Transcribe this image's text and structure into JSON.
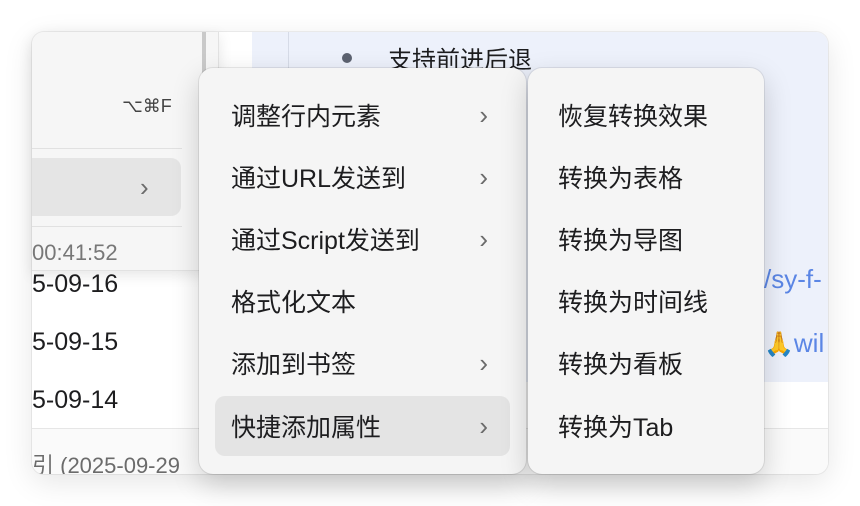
{
  "background": {
    "bullet_text": "支持前进后退",
    "link_a": "/sy-f-",
    "link_b_emoji": "🙏",
    "link_b_text": "wil",
    "dates": [
      "5-09-16",
      "5-09-15",
      "5-09-14"
    ],
    "footer_text": "引 (2025-09-29"
  },
  "left_popover": {
    "shortcut": "⌥⌘F",
    "chevron": "›",
    "time_text": "00:41:52"
  },
  "primary_menu": {
    "items": [
      {
        "label": "调整行内元素",
        "has_submenu": true
      },
      {
        "label": "通过URL发送到",
        "has_submenu": true
      },
      {
        "label": "通过Script发送到",
        "has_submenu": true
      },
      {
        "label": "格式化文本",
        "has_submenu": false
      },
      {
        "label": "添加到书签",
        "has_submenu": true
      },
      {
        "label": "快捷添加属性",
        "has_submenu": true
      }
    ],
    "chevron": "›"
  },
  "submenu": {
    "items": [
      {
        "label": "恢复转换效果"
      },
      {
        "label": "转换为表格"
      },
      {
        "label": "转换为导图"
      },
      {
        "label": "转换为时间线"
      },
      {
        "label": "转换为看板"
      },
      {
        "label": "转换为Tab"
      }
    ]
  },
  "colors": {
    "link": "#5b86e5",
    "menu_bg": "#f5f5f5",
    "highlight": "#e4e4e4",
    "editor_bg": "#edf1fb"
  }
}
